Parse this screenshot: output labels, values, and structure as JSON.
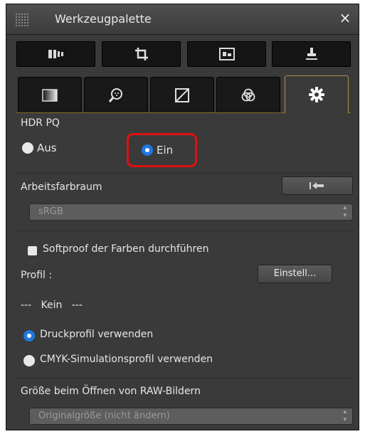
{
  "window": {
    "title": "Werkzeugpalette",
    "close_glyph": "×"
  },
  "top_tabs": [
    {
      "icon": "basic-adjust-icon"
    },
    {
      "icon": "crop-icon"
    },
    {
      "icon": "image-view-icon"
    },
    {
      "icon": "stamp-icon"
    }
  ],
  "tool_tabs": [
    {
      "icon": "tone-icon"
    },
    {
      "icon": "detail-zoom-icon"
    },
    {
      "icon": "curve-icon"
    },
    {
      "icon": "color-icon"
    },
    {
      "icon": "settings-gear-icon",
      "active": true
    }
  ],
  "hdr": {
    "label": "HDR PQ",
    "off_label": "Aus",
    "on_label": "Ein",
    "selected": "Ein"
  },
  "colorspace": {
    "label": "Arbeitsfarbraum",
    "value": "sRGB",
    "reset_icon": "reset-arrow-icon"
  },
  "softproof": {
    "checkbox_label": "Softproof der Farben durchführen",
    "checked": true,
    "profile_label": "Profil :",
    "settings_button": "Einstell...",
    "profile_value": "---   Kein   ---",
    "option_print": "Druckprofil verwenden",
    "option_cmyk": "CMYK-Simulationsprofil verwenden",
    "selected": "Druckprofil verwenden"
  },
  "raw_size": {
    "label": "Größe beim Öffnen von RAW-Bildern",
    "value": "Originalgröße (nicht ändern)"
  },
  "colors": {
    "panel_bg": "#3a3a3a",
    "accent_blue": "#1e78e0",
    "highlight_red": "#e01010",
    "active_tab_border": "#b38f47"
  }
}
